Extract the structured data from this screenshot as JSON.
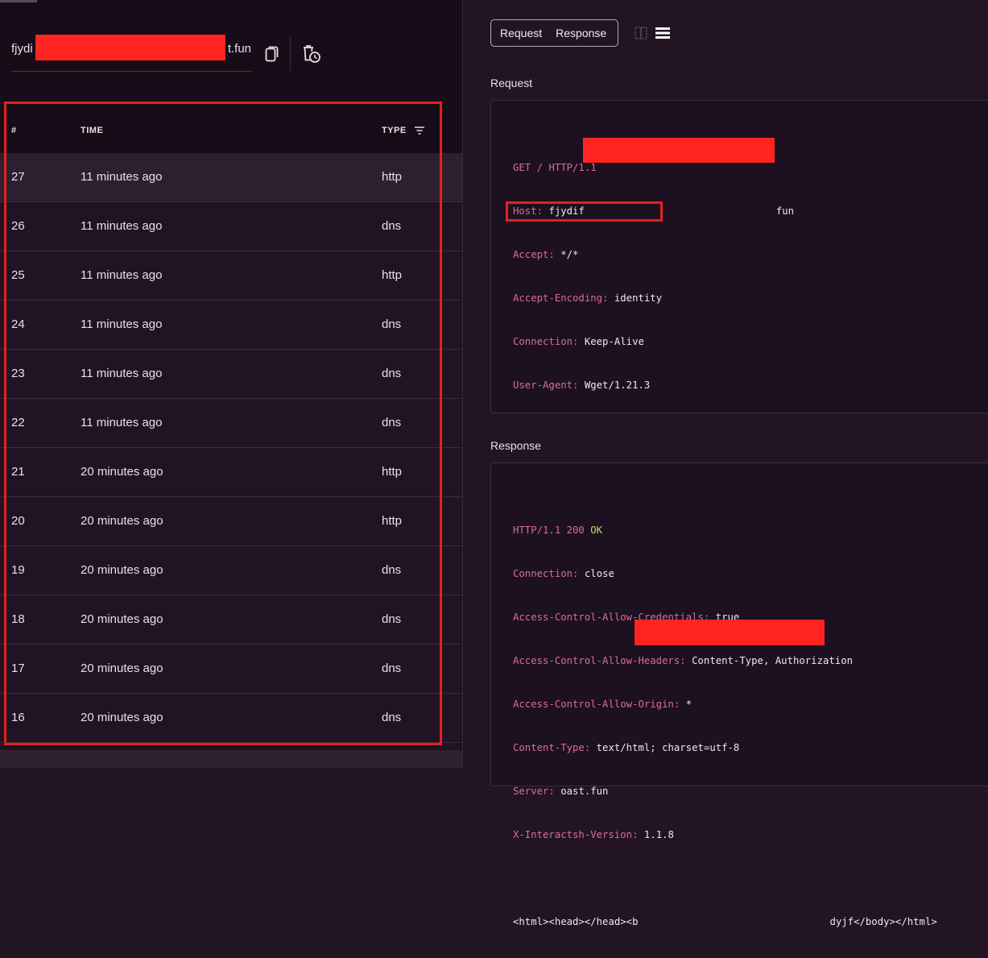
{
  "sidebar": {
    "url_prefix": "fjydi",
    "url_suffix": "t.fun",
    "table": {
      "headers": {
        "num": "#",
        "time": "TIME",
        "type": "TYPE"
      },
      "rows": [
        {
          "num": "27",
          "time": "11 minutes ago",
          "type": "http"
        },
        {
          "num": "26",
          "time": "11 minutes ago",
          "type": "dns"
        },
        {
          "num": "25",
          "time": "11 minutes ago",
          "type": "http"
        },
        {
          "num": "24",
          "time": "11 minutes ago",
          "type": "dns"
        },
        {
          "num": "23",
          "time": "11 minutes ago",
          "type": "dns"
        },
        {
          "num": "22",
          "time": "11 minutes ago",
          "type": "dns"
        },
        {
          "num": "21",
          "time": "20 minutes ago",
          "type": "http"
        },
        {
          "num": "20",
          "time": "20 minutes ago",
          "type": "http"
        },
        {
          "num": "19",
          "time": "20 minutes ago",
          "type": "dns"
        },
        {
          "num": "18",
          "time": "20 minutes ago",
          "type": "dns"
        },
        {
          "num": "17",
          "time": "20 minutes ago",
          "type": "dns"
        },
        {
          "num": "16",
          "time": "20 minutes ago",
          "type": "dns"
        }
      ]
    }
  },
  "detail": {
    "tabs": {
      "request": "Request",
      "response": "Response"
    },
    "request": {
      "label": "Request",
      "request_line": "GET / HTTP/1.1",
      "headers": [
        {
          "key": "Host:",
          "value": "fjydif",
          "value_suffix": "fun"
        },
        {
          "key": "Accept:",
          "value": "*/*"
        },
        {
          "key": "Accept-Encoding:",
          "value": "identity"
        },
        {
          "key": "Connection:",
          "value": "Keep-Alive"
        },
        {
          "key": "User-Agent:",
          "value": "Wget/1.21.3"
        }
      ]
    },
    "response": {
      "label": "Response",
      "status_proto": "HTTP/1.1 200",
      "status_text": "OK",
      "headers": [
        {
          "key": "Connection:",
          "value": "close"
        },
        {
          "key": "Access-Control-Allow-Credentials:",
          "value": "true"
        },
        {
          "key": "Access-Control-Allow-Headers:",
          "value": "Content-Type, Authorization"
        },
        {
          "key": "Access-Control-Allow-Origin:",
          "value": "*"
        },
        {
          "key": "Content-Type:",
          "value": "text/html; charset=utf-8"
        },
        {
          "key": "Server:",
          "value": "oast.fun"
        },
        {
          "key": "X-Interactsh-Version:",
          "value": "1.1.8"
        }
      ],
      "body_prefix": "<html><head></head><b",
      "body_suffix": "dyjf</body></html>"
    }
  },
  "colors": {
    "annotation": "#e3211e",
    "redaction": "#ff2420",
    "header_key": "#d96f8d",
    "status_ok": "#b6e06a"
  },
  "icons": [
    "copy-icon",
    "clear-history-icon",
    "filter-icon",
    "split-layout-icon",
    "stacked-layout-icon"
  ]
}
